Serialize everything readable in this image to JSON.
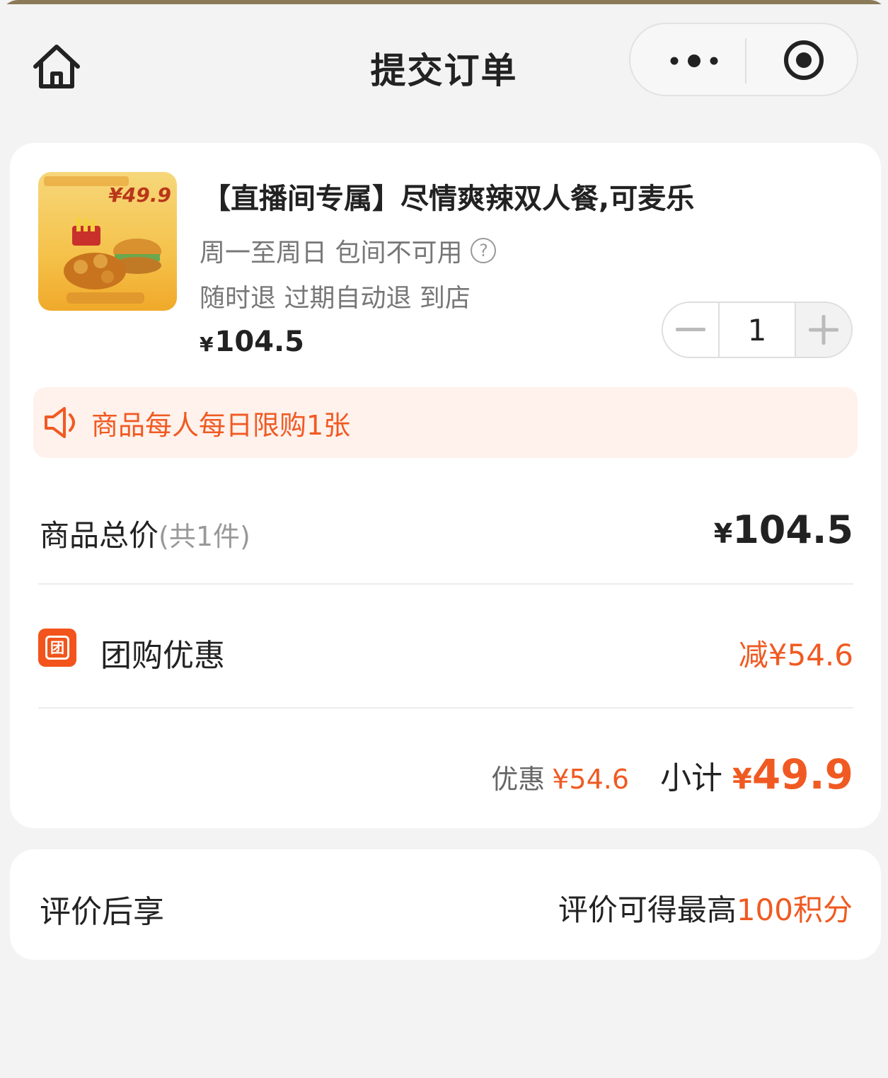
{
  "header": {
    "title": "提交订单",
    "home_icon": "home-icon",
    "more_icon": "more-dots-icon",
    "close_icon": "target-circle-icon"
  },
  "product": {
    "image_badge": "¥49.9",
    "title": "【直播间专属】尽情爽辣双人餐,可麦乐",
    "availability": "周一至周日 包间不可用",
    "help_icon": "?",
    "refund_policy": "随时退 过期自动退 到店",
    "price_symbol": "¥",
    "price": "104.5",
    "quantity": "1"
  },
  "notice": {
    "text": "商品每人每日限购1张",
    "icon": "speaker-icon"
  },
  "summary": {
    "total_label": "商品总价",
    "total_count": "(共1件)",
    "total_symbol": "¥",
    "total_value": "104.5",
    "group_icon_char": "团",
    "group_label": "团购优惠",
    "group_value": "减¥54.6",
    "discount_label": "优惠",
    "discount_value": "¥54.6",
    "subtotal_label": "小计",
    "subtotal_symbol": "¥",
    "subtotal_value": "49.9"
  },
  "review": {
    "label": "评价后享",
    "value_prefix": "评价可得最高",
    "value_highlight": "100积分"
  },
  "colors": {
    "accent": "#f05a22",
    "background": "#f3f3f3",
    "card": "#ffffff",
    "notice_bg": "#fff1ec"
  }
}
